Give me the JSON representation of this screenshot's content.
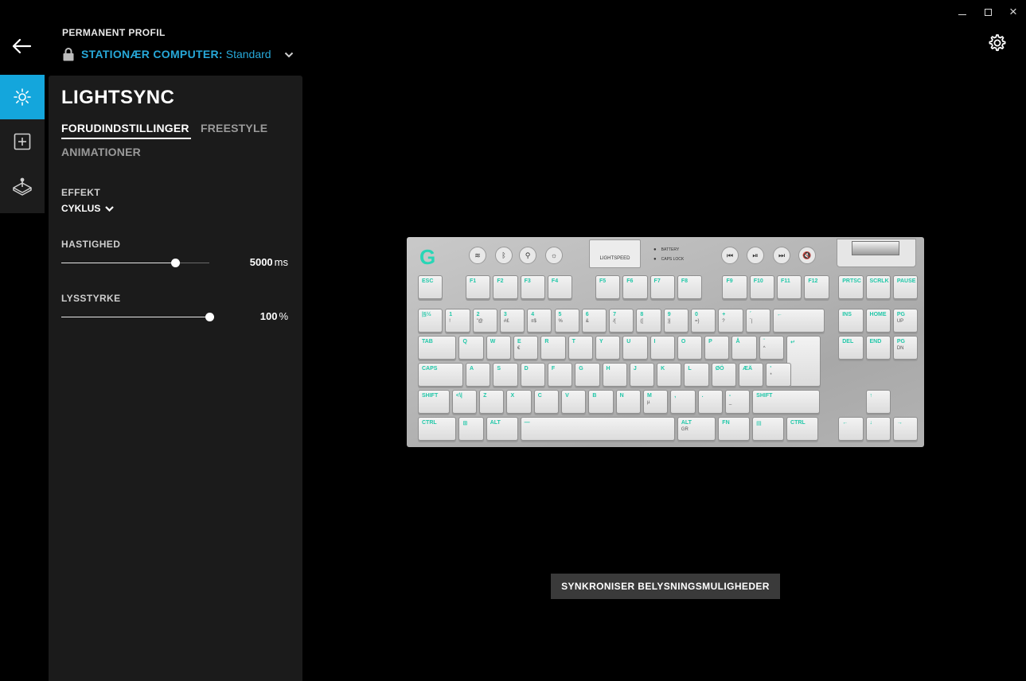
{
  "window": {
    "minimize": "–",
    "maximize": "□",
    "close": "×"
  },
  "profile": {
    "label": "PERMANENT PROFIL",
    "name": "STATIONÆR COMPUTER:",
    "preset": "Standard"
  },
  "sidebar": {
    "items": [
      {
        "icon": "lightsync-icon",
        "active": true
      },
      {
        "icon": "assignments-icon",
        "active": false
      },
      {
        "icon": "game-mode-icon",
        "active": false
      }
    ]
  },
  "panel": {
    "title": "LIGHTSYNC",
    "tabs": [
      "FORUDINDSTILLINGER",
      "FREESTYLE",
      "ANIMATIONER"
    ],
    "active_tab": 0,
    "effect_label": "EFFEKT",
    "effect_value": "CYKLUS",
    "speed_label": "HASTIGHED",
    "speed_value": "5000",
    "speed_unit": "ms",
    "speed_fraction": 0.77,
    "brightness_label": "LYSSTYRKE",
    "brightness_value": "100",
    "brightness_unit": "%",
    "brightness_fraction": 1.0
  },
  "keyboard": {
    "brand_label": "LIGHTSPEED",
    "status": [
      "BATTERY",
      "CAPS LOCK"
    ],
    "logo": "G",
    "accent": "#28d6b6",
    "keys": {
      "fn_row": [
        "ESC",
        "F1",
        "F2",
        "F3",
        "F4",
        "F5",
        "F6",
        "F7",
        "F8",
        "F9",
        "F10",
        "F11",
        "F12",
        "PRTSC",
        "SCRLK",
        "PAUSE"
      ],
      "num_row": [
        "|§½",
        "1 !",
        "2 \"@",
        "3 #£",
        "4 ¤$",
        "5 %",
        "6 &",
        "7 /{",
        "8 ([",
        "9 )]",
        "0 =}",
        "+ ?",
        "´ `|",
        "←",
        "INS",
        "HOME",
        "PG UP"
      ],
      "q_row": [
        "TAB",
        "Q",
        "W",
        "E €",
        "R",
        "T",
        "Y",
        "U",
        "I",
        "O",
        "P",
        "Å",
        "¨ ^",
        "↵",
        "DEL",
        "END",
        "PG DN"
      ],
      "a_row": [
        "CAPS",
        "A",
        "S",
        "D",
        "F",
        "G",
        "H",
        "J",
        "K",
        "L",
        "ØÖ",
        "ÆÄ",
        "' *"
      ],
      "z_row": [
        "SHIFT",
        "<\\|",
        "Z",
        "X",
        "C",
        "V",
        "B",
        "N",
        "M µ",
        ",  ;",
        ".  :",
        "- _",
        "SHIFT",
        "↑"
      ],
      "bottom_row": [
        "CTRL",
        "⊞",
        "ALT",
        "—",
        "ALT GR",
        "FN",
        "▤",
        "CTRL",
        "←",
        "↓",
        "→"
      ]
    }
  },
  "sync_button": "SYNKRONISER BELYSNINGSMULIGHEDER"
}
